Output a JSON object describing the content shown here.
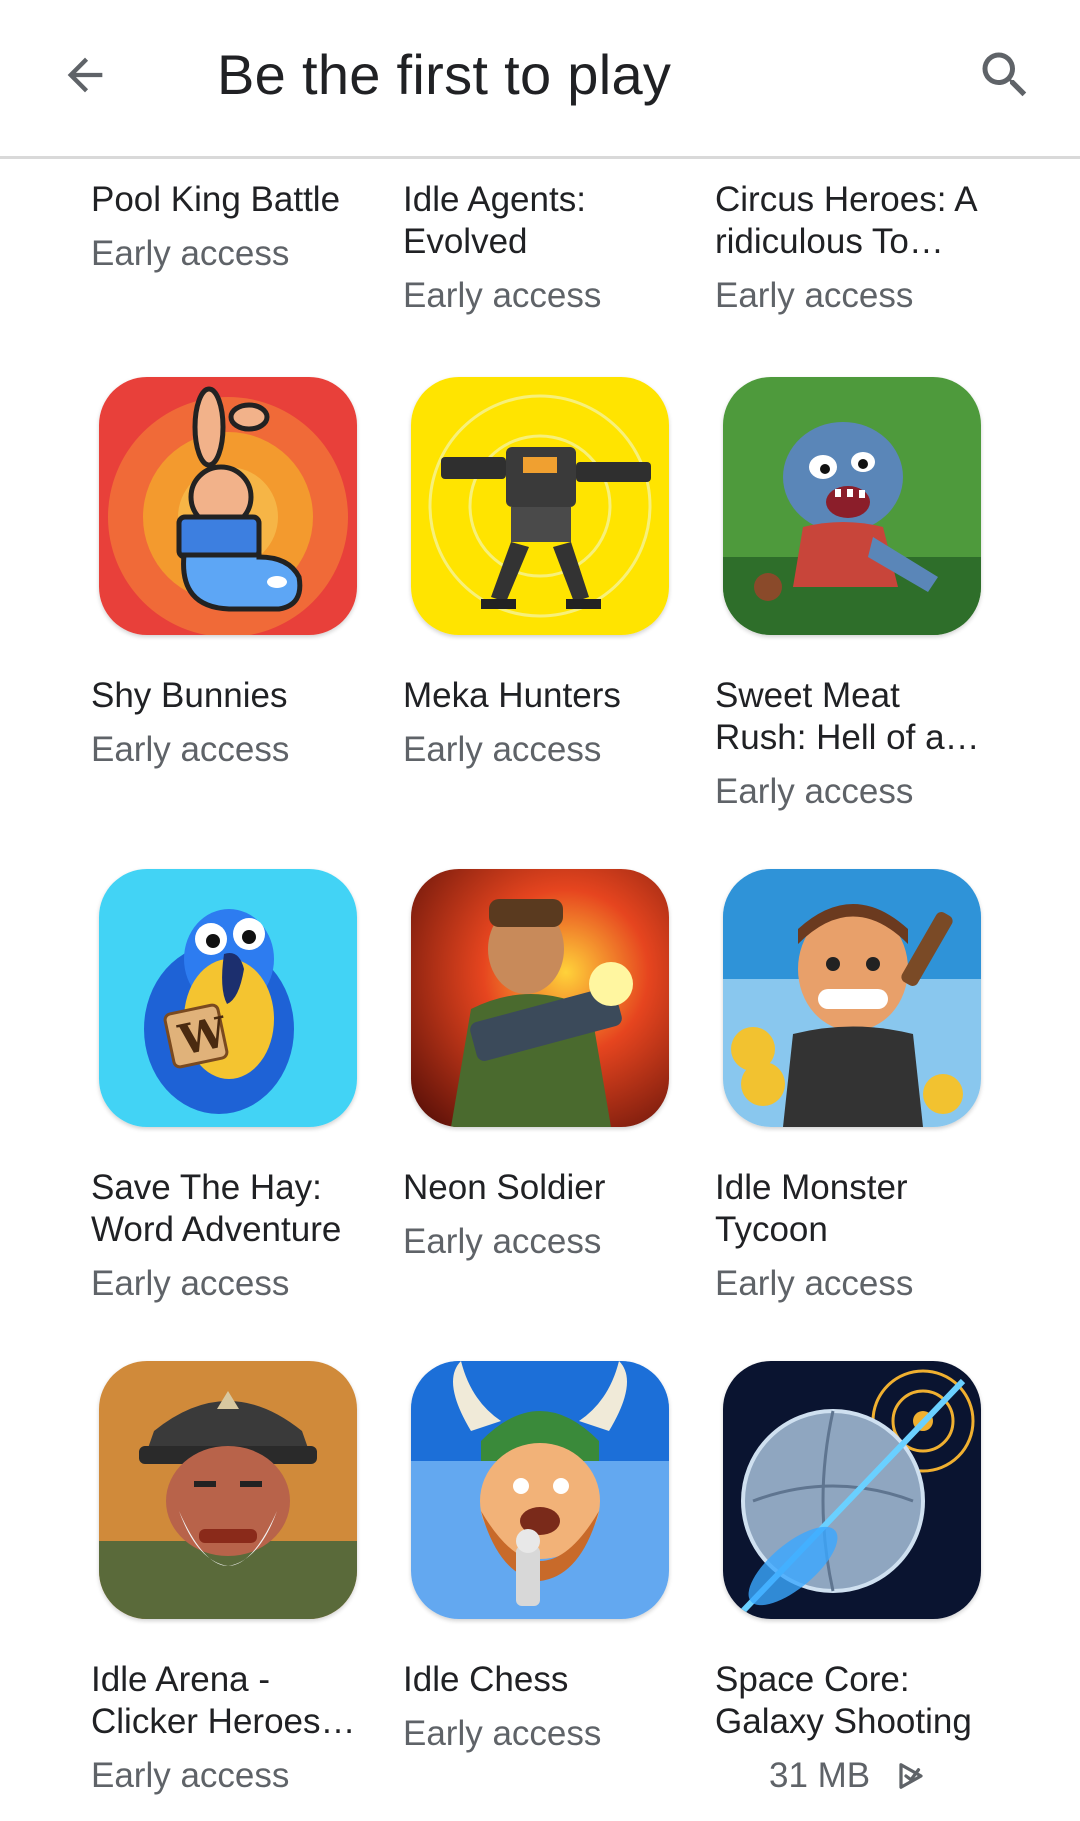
{
  "header": {
    "title": "Be the first to play"
  },
  "apps": [
    {
      "name": "Pool King Battle",
      "sub": "Early access"
    },
    {
      "name": "Idle Agents: Evolved",
      "sub": "Early access"
    },
    {
      "name": "Circus Heroes: A ridiculous To…",
      "sub": "Early access"
    },
    {
      "name": "Shy Bunnies",
      "sub": "Early access",
      "icon": "bunny-in-boot-icon",
      "colors": [
        "#e8403a",
        "#f39a2e"
      ]
    },
    {
      "name": "Meka Hunters",
      "sub": "Early access",
      "icon": "mech-robot-icon",
      "colors": [
        "#ffe400",
        "#f0d400"
      ]
    },
    {
      "name": "Sweet Meat Rush: Hell of a …",
      "sub": "Early access",
      "icon": "zombie-monster-icon",
      "colors": [
        "#4e9a3c",
        "#6fb552"
      ]
    },
    {
      "name": "Save The Hay: Word Adventure",
      "sub": "Early access",
      "icon": "parrot-letter-icon",
      "colors": [
        "#42d3f5",
        "#1fbfe8"
      ]
    },
    {
      "name": "Neon Soldier",
      "sub": "Early access",
      "icon": "soldier-gun-icon",
      "colors": [
        "#e6451f",
        "#8a1d10"
      ]
    },
    {
      "name": "Idle Monster Tycoon",
      "sub": "Early access",
      "icon": "hunter-man-icon",
      "colors": [
        "#2f93d8",
        "#89c7ee"
      ]
    },
    {
      "name": "Idle Arena - Clicker Heroes …",
      "sub": "Early access",
      "icon": "old-warrior-icon",
      "colors": [
        "#d08a3a",
        "#6b4626"
      ]
    },
    {
      "name": "Idle Chess",
      "sub": "Early access",
      "icon": "viking-chess-icon",
      "colors": [
        "#1c6fd8",
        "#63a8f0"
      ]
    },
    {
      "name": "Space Core: Galaxy Shooting",
      "size": "31 MB",
      "icon": "planet-core-icon",
      "colors": [
        "#0a1430",
        "#2a66c9"
      ]
    }
  ]
}
